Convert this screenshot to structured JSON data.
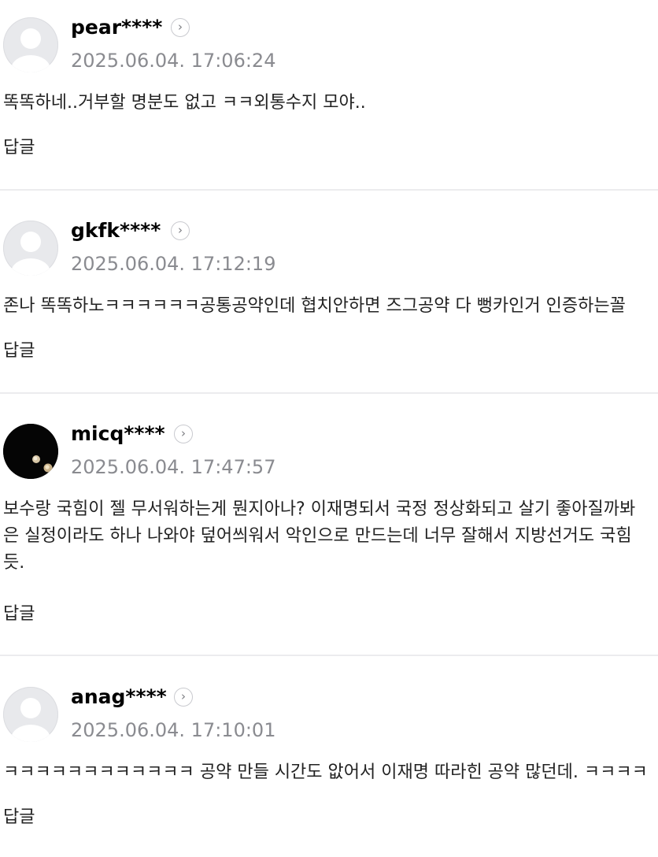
{
  "comments": [
    {
      "username": "pear****",
      "timestamp": "2025.06.04. 17:06:24",
      "lines": [
        "똑똑하네..거부할 명분도 없고 ㅋㅋ외통수지 모야.."
      ],
      "reply_label": "답글",
      "avatar": "default-avatar-icon"
    },
    {
      "username": "gkfk****",
      "timestamp": "2025.06.04. 17:12:19",
      "lines": [
        "존나 똑똑하노ㅋㅋㅋㅋㅋㅋ공통공약인데 협치안하면 즈그공약 다 뻥카인거 인증하는꼴"
      ],
      "reply_label": "답글",
      "avatar": "default-avatar-icon"
    },
    {
      "username": "micq****",
      "timestamp": "2025.06.04. 17:47:57",
      "lines": [
        "보수랑 국힘이 젤 무서워하는게 뭔지아나? 이재명되서 국정 정상화되고 살기 좋아질까봐",
        "은 실정이라도 하나 나와야 덮어씌워서 악인으로 만드는데 너무 잘해서 지방선거도 국힘",
        "듯."
      ],
      "reply_label": "답글",
      "avatar": "custom-photo-avatar"
    },
    {
      "username": "anag****",
      "timestamp": "2025.06.04. 17:10:01",
      "lines": [
        "ㅋㅋㅋㅋㅋㅋㅋㅋㅋㅋㅋㅋ 공약 만들 시간도 앖어서 이재명 따라힌 공약 많던데. ㅋㅋㅋㅋ"
      ],
      "reply_label": "답글",
      "avatar": "default-avatar-icon"
    }
  ],
  "profile_button_icon": "chevron-right-icon",
  "colors": {
    "username": "#000000",
    "timestamp": "#8a8b90",
    "body_text": "#222222",
    "divider": "#ececee",
    "avatar_bg": "#e8e9ec",
    "avatar_figure": "#ffffff"
  }
}
